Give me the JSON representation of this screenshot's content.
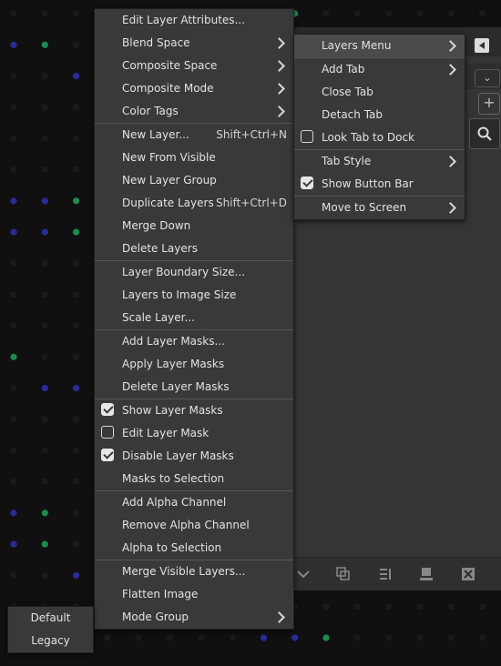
{
  "main_menu": {
    "items": [
      {
        "label": "Edit Layer Attributes...",
        "accel": "",
        "submenu": false
      },
      {
        "label": "Blend Space",
        "accel": "",
        "submenu": true
      },
      {
        "label": "Composite Space",
        "accel": "",
        "submenu": true
      },
      {
        "label": "Composite Mode",
        "accel": "",
        "submenu": true
      },
      {
        "label": "Color Tags",
        "accel": "",
        "submenu": true
      },
      {
        "label": "New Layer...",
        "accel": "Shift+Ctrl+N",
        "submenu": false
      },
      {
        "label": "New From Visible",
        "accel": "",
        "submenu": false
      },
      {
        "label": "New Layer Group",
        "accel": "",
        "submenu": false
      },
      {
        "label": "Duplicate Layers",
        "accel": "Shift+Ctrl+D",
        "submenu": false
      },
      {
        "label": "Merge Down",
        "accel": "",
        "submenu": false
      },
      {
        "label": "Delete Layers",
        "accel": "",
        "submenu": false
      },
      {
        "label": "Layer Boundary Size...",
        "accel": "",
        "submenu": false
      },
      {
        "label": "Layers to Image Size",
        "accel": "",
        "submenu": false
      },
      {
        "label": "Scale Layer...",
        "accel": "",
        "submenu": false
      },
      {
        "label": "Add Layer Masks...",
        "accel": "",
        "submenu": false
      },
      {
        "label": "Apply Layer Masks",
        "accel": "",
        "submenu": false
      },
      {
        "label": "Delete Layer Masks",
        "accel": "",
        "submenu": false
      },
      {
        "label": "Show Layer Masks",
        "checked": true
      },
      {
        "label": "Edit Layer Mask",
        "checked": false
      },
      {
        "label": "Disable Layer Masks",
        "checked": true
      },
      {
        "label": "Masks to Selection",
        "accel": "",
        "submenu": false
      },
      {
        "label": "Add Alpha Channel",
        "accel": "",
        "submenu": false
      },
      {
        "label": "Remove Alpha Channel",
        "accel": "",
        "submenu": false
      },
      {
        "label": "Alpha to Selection",
        "accel": "",
        "submenu": false
      },
      {
        "label": "Merge Visible Layers...",
        "accel": "",
        "submenu": false
      },
      {
        "label": "Flatten Image",
        "accel": "",
        "submenu": false
      },
      {
        "label": "Mode Group",
        "accel": "",
        "submenu": true
      }
    ]
  },
  "tab_menu": {
    "items": [
      {
        "label": "Layers Menu",
        "submenu": true
      },
      {
        "label": "Add Tab",
        "submenu": true
      },
      {
        "label": "Close Tab",
        "submenu": false
      },
      {
        "label": "Detach Tab",
        "submenu": false
      },
      {
        "label": "Look Tab to Dock",
        "checked": false
      },
      {
        "label": "Tab Style",
        "submenu": true
      },
      {
        "label": "Show Button Bar",
        "checked": true
      },
      {
        "label": "Move to Screen",
        "submenu": true
      }
    ]
  },
  "mode_menu": {
    "items": [
      {
        "label": "Default"
      },
      {
        "label": "Legacy"
      }
    ]
  },
  "dock": {
    "dropdown_glyph": "⌄",
    "plus_glyph": "+"
  },
  "colors": {
    "menu_bg": "#393939",
    "highlight": "#4a4a4a",
    "canvas_bg": "#101010",
    "dot_green": "#1f8a50",
    "dot_blue": "#2a2a9a",
    "dot_dark": "#1a1a1a"
  }
}
